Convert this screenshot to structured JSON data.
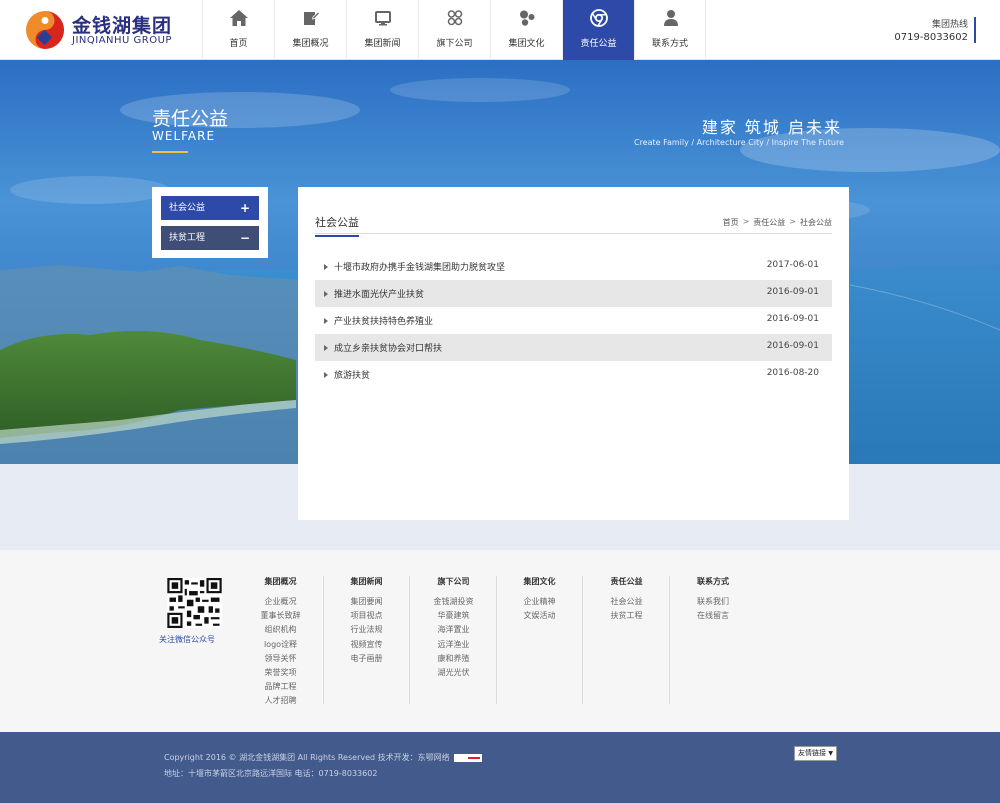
{
  "header": {
    "logo_cn": "金钱湖集团",
    "logo_en": "JINQIANHU GROUP",
    "nav": [
      {
        "label": "首页",
        "icon": "home-icon"
      },
      {
        "label": "集团概况",
        "icon": "edit-icon"
      },
      {
        "label": "集团新闻",
        "icon": "monitor-icon"
      },
      {
        "label": "旗下公司",
        "icon": "grid-icon"
      },
      {
        "label": "集团文化",
        "icon": "circles-icon"
      },
      {
        "label": "责任公益",
        "icon": "chrome-icon",
        "active": true
      },
      {
        "label": "联系方式",
        "icon": "user-icon"
      }
    ],
    "hotline_label": "集团热线",
    "hotline_number": "0719-8033602"
  },
  "banner": {
    "title_cn": "责任公益",
    "title_en": "WELFARE",
    "slogan": "建家  筑城  启未来",
    "slogan_en": "Create Family / Architecture City / Inspire The Future"
  },
  "side_menu": [
    {
      "label": "社会公益",
      "sign": "+",
      "active": true
    },
    {
      "label": "扶贫工程",
      "sign": "−",
      "active": false
    }
  ],
  "content": {
    "title": "社会公益",
    "breadcrumb": [
      "首页",
      "责任公益",
      "社会公益"
    ],
    "breadcrumb_sep": ">",
    "items": [
      {
        "title": "十堰市政府办携手金钱湖集团助力脱贫攻坚",
        "date": "2017-06-01"
      },
      {
        "title": "推进水面光伏产业扶贫",
        "date": "2016-09-01"
      },
      {
        "title": "产业扶贫扶持特色养殖业",
        "date": "2016-09-01"
      },
      {
        "title": "成立乡亲扶贫协会对口帮扶",
        "date": "2016-09-01"
      },
      {
        "title": "旅游扶贫",
        "date": "2016-08-20"
      }
    ]
  },
  "footer": {
    "qr_label": "关注微信公众号",
    "columns": [
      {
        "title": "集团概况",
        "links": [
          "企业概况",
          "董事长致辞",
          "组织机构",
          "logo诠释",
          "领导关怀",
          "荣誉奖项",
          "品牌工程",
          "人才招聘"
        ]
      },
      {
        "title": "集团新闻",
        "links": [
          "集团要闻",
          "项目视点",
          "行业法规",
          "视频宣传",
          "电子画册"
        ]
      },
      {
        "title": "旗下公司",
        "links": [
          "金钱湖投资",
          "华豪建筑",
          "海洋置业",
          "远洋渔业",
          "康和养殖",
          "湖光光伏"
        ]
      },
      {
        "title": "集团文化",
        "links": [
          "企业精神",
          "文娱活动"
        ]
      },
      {
        "title": "责任公益",
        "links": [
          "社会公益",
          "扶贫工程"
        ]
      },
      {
        "title": "联系方式",
        "links": [
          "联系我们",
          "在线留言"
        ]
      }
    ]
  },
  "bottom": {
    "copyright": "Copyright 2016 ©  湖北金钱湖集团   All Rights Reserved   技术开发：东鄂网络",
    "address": "地址：十堰市茅箭区北京路远洋国际   电话：0719-8033602",
    "friend_links_label": "友情链接"
  },
  "colors": {
    "primary": "#2d4aa8",
    "side_inactive": "#3e4e76",
    "bottom_bar": "#435a8c",
    "accent_line": "#f0c040"
  }
}
